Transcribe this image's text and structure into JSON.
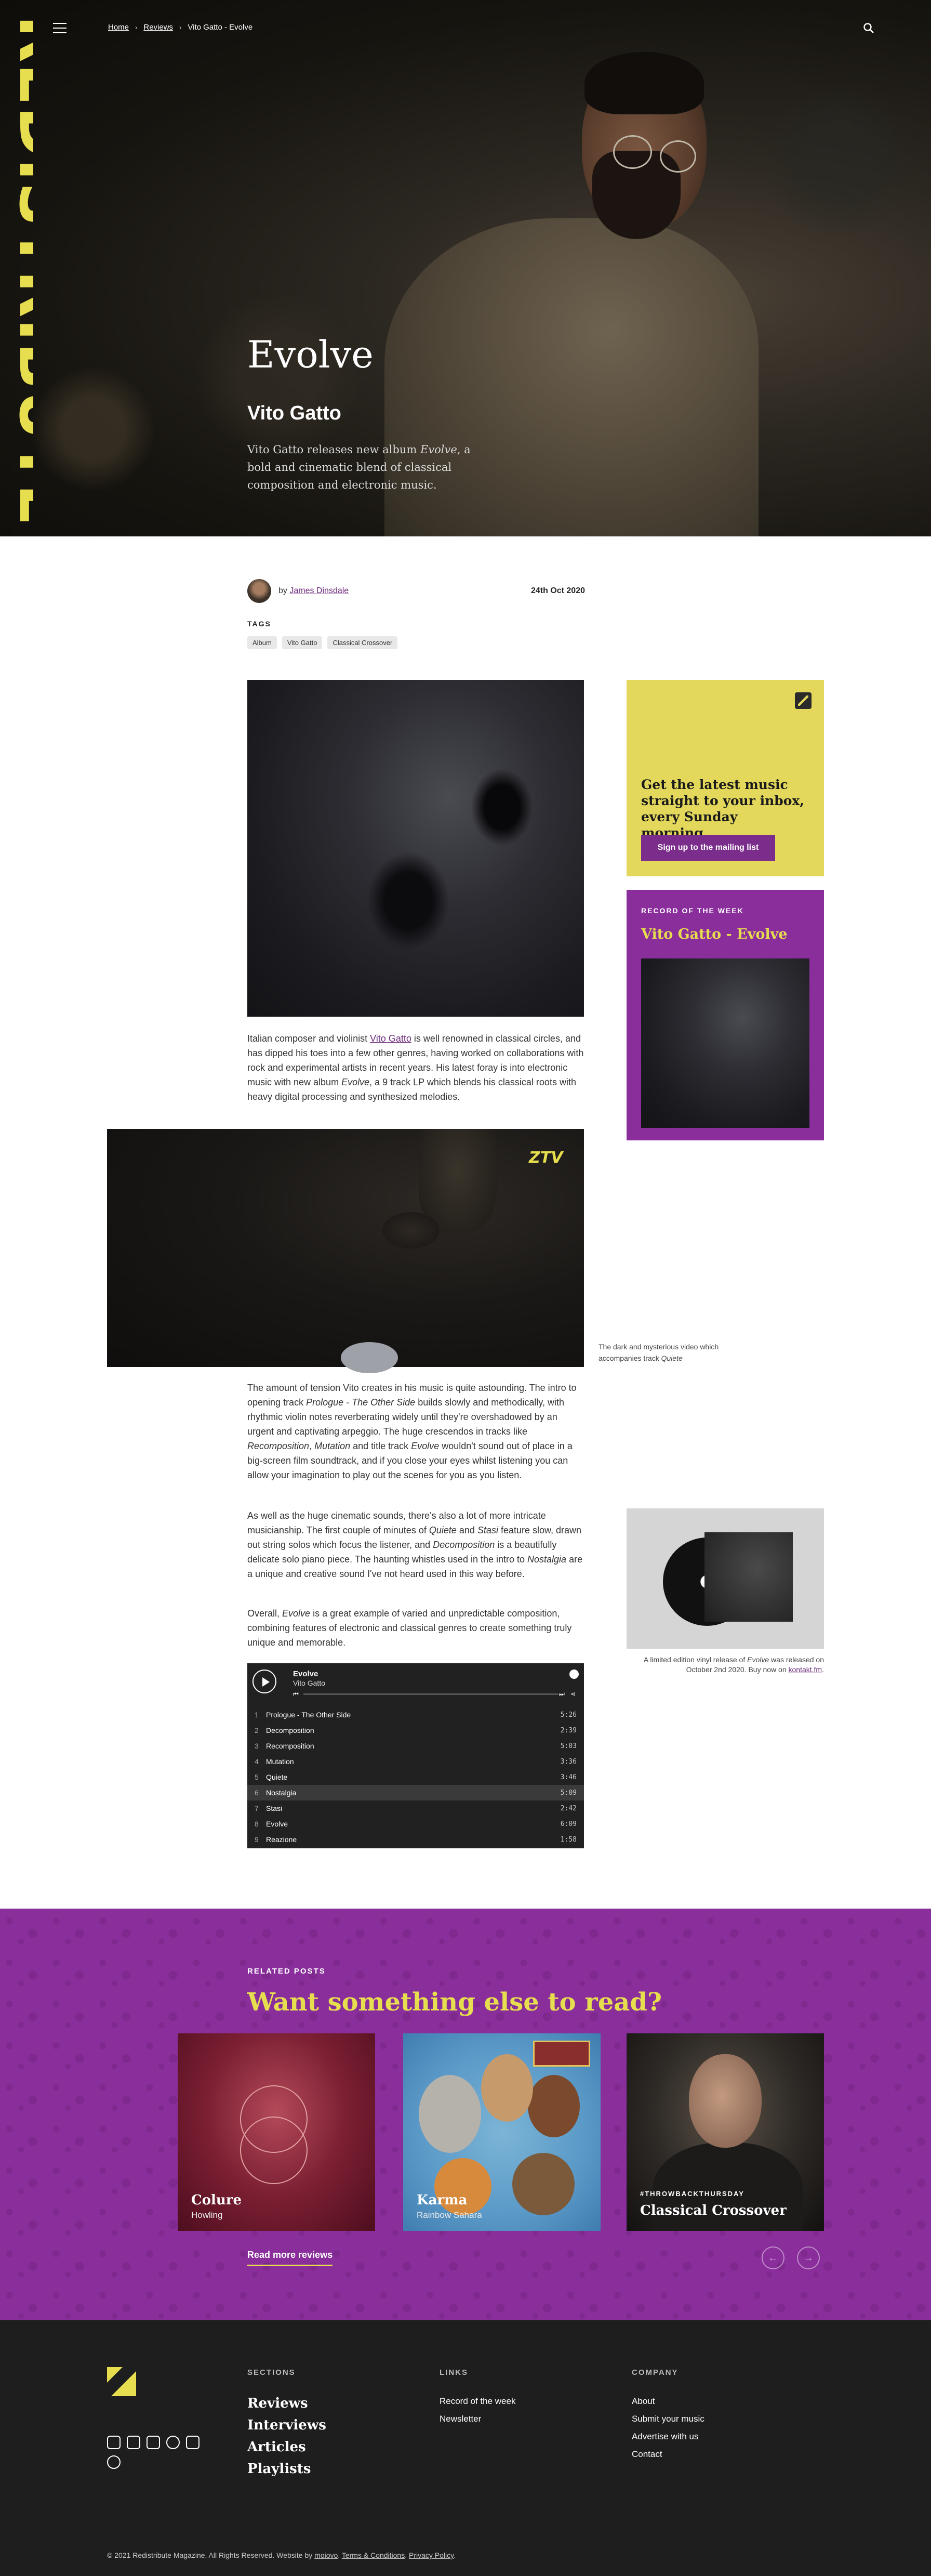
{
  "brand": {
    "name": "REDISTRIBUTE",
    "accent": "#e6de4f",
    "purple": "#8a2e9c"
  },
  "nav": {
    "breadcrumbs": [
      "Home",
      "Reviews",
      "Vito Gatto - Evolve"
    ],
    "menu_icon": "hamburger-icon",
    "search_icon": "search-icon"
  },
  "hero": {
    "title": "Evolve",
    "artist": "Vito Gatto",
    "desc_pre": "Vito Gatto releases new album ",
    "desc_em": "Evolve",
    "desc_post": ", a bold and cinematic blend of classical composition and electronic music."
  },
  "meta": {
    "by": "by",
    "author": "James Dinsdale",
    "date": "24th Oct 2020"
  },
  "tags": {
    "heading": "TAGS",
    "items": [
      "Album",
      "Vito Gatto",
      "Classical Crossover"
    ]
  },
  "article": {
    "p1_a": "Italian composer and violinist ",
    "p1_link": "Vito Gatto",
    "p1_b": " is well renowned in classical circles, and has dipped his toes into a few other genres, having worked on collaborations with rock and experimental artists in recent years. His latest foray is into electronic music with new album ",
    "p1_em": "Evolve",
    "p1_c": ", a 9 track LP which blends his classical roots with heavy digital processing and synthesized melodies.",
    "video_logo": "ZTV",
    "video_caption_a": "The dark and mysterious video which accompanies track ",
    "video_caption_em": "Quiete",
    "p2_a": "The amount of tension Vito creates in his music is quite astounding. The intro to opening track ",
    "p2_em1": "Prologue - The Other Side",
    "p2_b": " builds slowly and methodically, with rhythmic violin notes reverberating widely until they're overshadowed by an urgent and captivating arpeggio. The huge crescendos in tracks like ",
    "p2_em2": "Recomposition",
    "p2_c": ", ",
    "p2_em3": "Mutation",
    "p2_d": " and title track ",
    "p2_em4": "Evolve",
    "p2_e": " wouldn't sound out of place in a big-screen film soundtrack, and if you close your eyes whilst listening you can allow your imagination to play out the scenes for you as you listen.",
    "p3_a": "As well as the huge cinematic sounds, there's also a lot of more intricate musicianship. The first couple of minutes of ",
    "p3_em1": "Quiete",
    "p3_b": " and ",
    "p3_em2": "Stasi",
    "p3_c": " feature slow, drawn out string solos which focus the listener, and ",
    "p3_em3": "Decomposition",
    "p3_d": " is a beautifully delicate solo piano piece. The haunting whistles used in the intro to ",
    "p3_em4": "Nostalgia",
    "p3_e": " are a unique and creative sound I've not heard used in this way before.",
    "p4_a": "Overall, ",
    "p4_em": "Evolve",
    "p4_b": " is a great example of varied and unpredictable composition, combining features of electronic and classical genres to create something truly unique and memorable.",
    "vinyl_caption_a": "A limited edition vinyl release of ",
    "vinyl_caption_em": "Evolve",
    "vinyl_caption_b": " was released on October 2nd 2020. Buy now on ",
    "vinyl_caption_link": "kontakt.fm",
    "vinyl_caption_c": "."
  },
  "sidebar": {
    "signup_text": "Get the latest music straight to your inbox, every Sunday morning.",
    "signup_button": "Sign up to the mailing list",
    "rotw_kicker": "RECORD OF THE WEEK",
    "rotw_title": "Vito Gatto - Evolve"
  },
  "player": {
    "album": "Evolve",
    "artist": "Vito Gatto",
    "tracks": [
      {
        "n": "1",
        "name": "Prologue - The Other Side",
        "dur": "5:26"
      },
      {
        "n": "2",
        "name": "Decomposition",
        "dur": "2:39"
      },
      {
        "n": "3",
        "name": "Recomposition",
        "dur": "5:03"
      },
      {
        "n": "4",
        "name": "Mutation",
        "dur": "3:36"
      },
      {
        "n": "5",
        "name": "Quiete",
        "dur": "3:46"
      },
      {
        "n": "6",
        "name": "Nostalgia",
        "dur": "5:09"
      },
      {
        "n": "7",
        "name": "Stasi",
        "dur": "2:42"
      },
      {
        "n": "8",
        "name": "Evolve",
        "dur": "6:09"
      },
      {
        "n": "9",
        "name": "Reazione",
        "dur": "1:58"
      }
    ]
  },
  "related": {
    "kicker": "RELATED POSTS",
    "heading": "Want something else to read?",
    "cards": [
      {
        "title": "Colure",
        "sub": "Howling",
        "kicker": ""
      },
      {
        "title": "Karma",
        "sub": "Rainbow Sahara",
        "kicker": ""
      },
      {
        "title": "Classical Crossover",
        "sub": "",
        "kicker": "#THROWBACKTHURSDAY"
      }
    ],
    "read_more": "Read more reviews",
    "prev_icon": "arrow-left-icon",
    "next_icon": "arrow-right-icon"
  },
  "footer": {
    "sections_h": "SECTIONS",
    "sections": [
      "Reviews",
      "Interviews",
      "Articles",
      "Playlists"
    ],
    "links_h": "LINKS",
    "links": [
      "Record of the week",
      "Newsletter"
    ],
    "company_h": "COMPANY",
    "company": [
      "About",
      "Submit your music",
      "Advertise with us",
      "Contact"
    ],
    "social_icons": [
      "instagram-icon",
      "facebook-icon",
      "twitter-icon",
      "spotify-icon",
      "flipboard-icon",
      "threads-icon"
    ],
    "copy_a": "© 2021 Redistribute Magazine. All Rights Reserved. Website by ",
    "copy_link1": "moiovo",
    "copy_b": ". ",
    "copy_link2": "Terms & Conditions",
    "copy_c": ". ",
    "copy_link3": "Privacy Policy",
    "copy_d": "."
  }
}
